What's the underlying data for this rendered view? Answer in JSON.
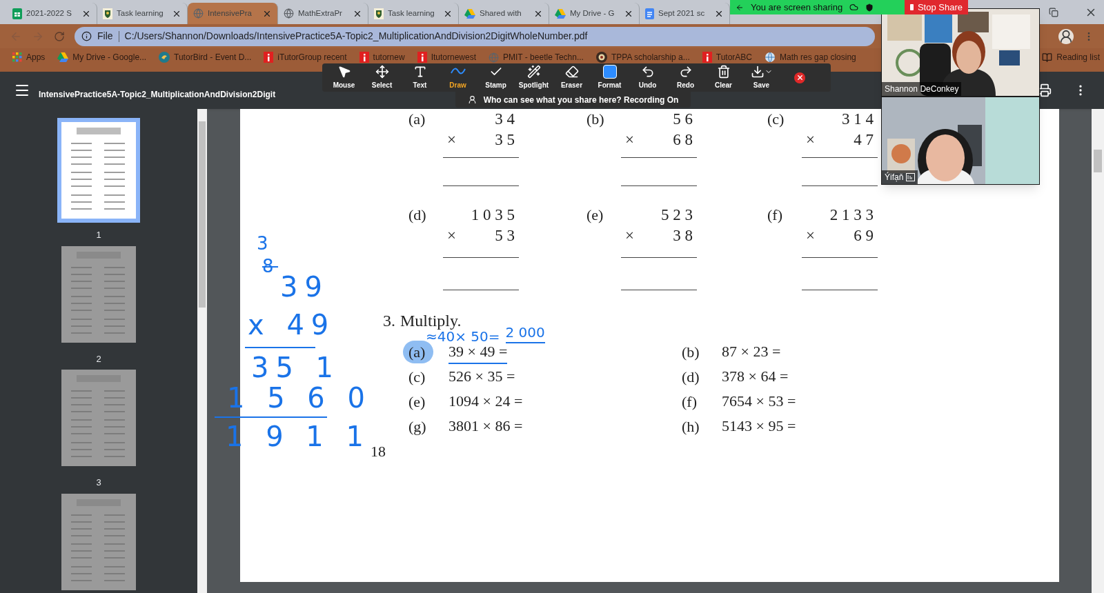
{
  "browser": {
    "tabs": [
      {
        "title": "2021-2022 S",
        "kind": "sheets",
        "selected": false
      },
      {
        "title": "Task learning",
        "kind": "crest",
        "selected": false
      },
      {
        "title": "IntensivePra",
        "kind": "globe",
        "selected": true
      },
      {
        "title": "MathExtraPr",
        "kind": "globe",
        "selected": false
      },
      {
        "title": "Task learning",
        "kind": "crest",
        "selected": false
      },
      {
        "title": "Shared with",
        "kind": "drive",
        "selected": false
      },
      {
        "title": "My Drive - G",
        "kind": "drive",
        "selected": false
      },
      {
        "title": "Sept 2021 sc",
        "kind": "docs",
        "selected": false
      }
    ],
    "address": {
      "scheme": "File",
      "url": "C:/Users/Shannon/Downloads/IntensivePractice5A-Topic2_MultiplicationAndDivision2DigitWholeNumber.pdf"
    },
    "bookmarks": [
      {
        "label": "Apps",
        "kind": "apps"
      },
      {
        "label": "My Drive - Google...",
        "kind": "drive"
      },
      {
        "label": "TutorBird - Event D...",
        "kind": "bird"
      },
      {
        "label": "iTutorGroup recent",
        "kind": "red"
      },
      {
        "label": "tutornew",
        "kind": "red"
      },
      {
        "label": "Itutornewest",
        "kind": "red"
      },
      {
        "label": "PMIT - beetle Techn...",
        "kind": "globe"
      },
      {
        "label": "TPPA scholarship a...",
        "kind": "seal"
      },
      {
        "label": "TutorABC",
        "kind": "red"
      },
      {
        "label": "Math res gap closing",
        "kind": "web"
      }
    ],
    "reading_list": "Reading list"
  },
  "sharing": {
    "status": "You are screen sharing",
    "stop": "Stop Share"
  },
  "annotate": {
    "tools": [
      {
        "label": "Mouse",
        "kind": "mouse",
        "selected": false
      },
      {
        "label": "Select",
        "kind": "select",
        "selected": false
      },
      {
        "label": "Text",
        "kind": "text",
        "selected": false
      },
      {
        "label": "Draw",
        "kind": "draw",
        "selected": true
      },
      {
        "label": "Stamp",
        "kind": "stamp",
        "selected": false
      },
      {
        "label": "Spotlight",
        "kind": "spotlight",
        "selected": false
      },
      {
        "label": "Eraser",
        "kind": "eraser",
        "selected": false
      },
      {
        "label": "Format",
        "kind": "format",
        "selected": false
      },
      {
        "label": "Undo",
        "kind": "undo",
        "selected": false
      },
      {
        "label": "Redo",
        "kind": "redo",
        "selected": false
      },
      {
        "label": "Clear",
        "kind": "clear",
        "selected": false
      },
      {
        "label": "Save",
        "kind": "save",
        "selected": false
      }
    ],
    "notice": "Who can see what you share here? Recording On"
  },
  "viewer": {
    "title": "IntensivePractice5A-Topic2_MultiplicationAndDivision2Digit",
    "thumbnails": [
      {
        "page": "1",
        "selected": true
      },
      {
        "page": "2",
        "selected": false
      },
      {
        "page": "3",
        "selected": false
      },
      {
        "selected": false
      }
    ]
  },
  "document": {
    "problems": [
      {
        "label": "(a)",
        "top": "3 4",
        "sign": "×",
        "bottom": "3 5"
      },
      {
        "label": "(b)",
        "top": "5 6",
        "sign": "×",
        "bottom": "6 8"
      },
      {
        "label": "(c)",
        "top": "3 1 4",
        "sign": "×",
        "bottom": "4 7"
      },
      {
        "label": "(d)",
        "top": "1 0 3 5",
        "sign": "×",
        "bottom": "5 3"
      },
      {
        "label": "(e)",
        "top": "5 2 3",
        "sign": "×",
        "bottom": "3 8"
      },
      {
        "label": "(f)",
        "top": "2 1 3 3",
        "sign": "×",
        "bottom": "6 9"
      }
    ],
    "section": {
      "number": "3.",
      "title": "Multiply.",
      "items": [
        {
          "label": "(a)",
          "expression": "39 × 49 =",
          "highlighted": true
        },
        {
          "label": "(b)",
          "expression": "87 × 23 =",
          "highlighted": false
        },
        {
          "label": "(c)",
          "expression": "526 × 35 =",
          "highlighted": false
        },
        {
          "label": "(d)",
          "expression": "378 × 64 =",
          "highlighted": false
        },
        {
          "label": "(e)",
          "expression": "1094 × 24 =",
          "highlighted": false
        },
        {
          "label": "(f)",
          "expression": "7654 × 53 =",
          "highlighted": false
        },
        {
          "label": "(g)",
          "expression": "3801 × 86 =",
          "highlighted": false
        },
        {
          "label": "(h)",
          "expression": "5143 × 95 =",
          "highlighted": false
        }
      ]
    },
    "page_number": "18"
  },
  "ink": {
    "margin_work": [
      {
        "kind": "text",
        "text": "3",
        "struck": false
      },
      {
        "kind": "text",
        "text": "8",
        "struck": true
      },
      {
        "kind": "text",
        "text": "39",
        "struck": false
      },
      {
        "kind": "text",
        "text": "x 49",
        "struck": false
      },
      {
        "kind": "rule"
      },
      {
        "kind": "text",
        "text": "35 1",
        "struck": false
      },
      {
        "kind": "text",
        "text": "1 5 6 0",
        "struck": false
      },
      {
        "kind": "rule"
      },
      {
        "kind": "text",
        "text": "1 9 1 1",
        "struck": false
      }
    ],
    "estimate": "≈40× 50=",
    "estimate_result": "2 000"
  },
  "video": {
    "tiles": [
      {
        "name": "Shannon DeConkey",
        "kind": "adult",
        "captions": false
      },
      {
        "name": "Ýifạň",
        "kind": "child",
        "captions": true
      }
    ]
  }
}
